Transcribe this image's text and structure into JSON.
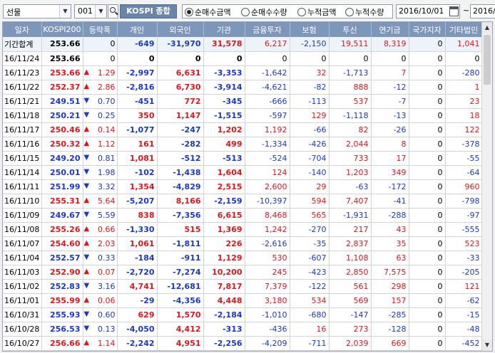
{
  "toolbar": {
    "market": "선물",
    "code": "001",
    "index_button": "KOSPI 종합",
    "radios": [
      {
        "label": "순매수금액",
        "checked": true
      },
      {
        "label": "순매수수량",
        "checked": false
      },
      {
        "label": "누적금액",
        "checked": false
      },
      {
        "label": "누적수량",
        "checked": false
      }
    ],
    "start_date": "2016/10/01",
    "tilde": "~",
    "end_date": "2016/"
  },
  "columns": [
    "일자",
    "KOSPI200",
    "등락폭",
    "개인",
    "외국인",
    "기관",
    "금융투자",
    "보험",
    "투신",
    "연기금",
    "국가지자",
    "기타법인"
  ],
  "rows": [
    {
      "d": "기간합계",
      "k": "253.66",
      "dir": "",
      "c": "0",
      "v": [
        "-649",
        "-31,970",
        "31,578",
        "6,217",
        "-2,150",
        "19,511",
        "8,319",
        "0",
        "1,041"
      ]
    },
    {
      "d": "16/11/24",
      "k": "253.66",
      "dir": "",
      "c": "0",
      "v": [
        "0",
        "0",
        "0",
        "0",
        "0",
        "0",
        "0",
        "0",
        "0"
      ]
    },
    {
      "d": "16/11/23",
      "k": "253.66",
      "dir": "up",
      "c": "1.29",
      "v": [
        "-2,997",
        "6,631",
        "-3,353",
        "-1,642",
        "32",
        "-1,713",
        "7",
        "0",
        "-280"
      ]
    },
    {
      "d": "16/11/22",
      "k": "252.37",
      "dir": "up",
      "c": "2.86",
      "v": [
        "-2,816",
        "6,730",
        "-3,914",
        "-4,621",
        "-82",
        "888",
        "-12",
        "0",
        "1"
      ]
    },
    {
      "d": "16/11/21",
      "k": "249.51",
      "dir": "down",
      "c": "0.70",
      "v": [
        "-451",
        "772",
        "-345",
        "-666",
        "-113",
        "537",
        "-7",
        "0",
        "23"
      ]
    },
    {
      "d": "16/11/18",
      "k": "250.21",
      "dir": "down",
      "c": "0.25",
      "v": [
        "350",
        "1,147",
        "-1,515",
        "-597",
        "129",
        "-1,118",
        "-13",
        "0",
        "18"
      ]
    },
    {
      "d": "16/11/17",
      "k": "250.46",
      "dir": "up",
      "c": "0.14",
      "v": [
        "-1,077",
        "-247",
        "1,202",
        "1,192",
        "-66",
        "82",
        "-26",
        "0",
        "122"
      ]
    },
    {
      "d": "16/11/16",
      "k": "250.32",
      "dir": "up",
      "c": "1.12",
      "v": [
        "161",
        "-282",
        "499",
        "-1,334",
        "-426",
        "2,044",
        "8",
        "0",
        "-378"
      ]
    },
    {
      "d": "16/11/15",
      "k": "249.20",
      "dir": "down",
      "c": "0.81",
      "v": [
        "1,081",
        "-512",
        "-513",
        "-524",
        "-704",
        "733",
        "17",
        "0",
        "-55"
      ]
    },
    {
      "d": "16/11/14",
      "k": "250.01",
      "dir": "down",
      "c": "1.98",
      "v": [
        "-102",
        "-1,438",
        "1,604",
        "124",
        "-140",
        "1,203",
        "349",
        "0",
        "-64"
      ]
    },
    {
      "d": "16/11/11",
      "k": "251.99",
      "dir": "down",
      "c": "3.32",
      "v": [
        "1,354",
        "-4,829",
        "2,515",
        "2,600",
        "29",
        "-63",
        "-172",
        "0",
        "960"
      ]
    },
    {
      "d": "16/11/10",
      "k": "255.31",
      "dir": "up",
      "c": "5.64",
      "v": [
        "-5,207",
        "8,166",
        "-2,159",
        "-10,397",
        "594",
        "7,407",
        "-41",
        "0",
        "-798"
      ]
    },
    {
      "d": "16/11/09",
      "k": "249.67",
      "dir": "down",
      "c": "5.59",
      "v": [
        "838",
        "-7,356",
        "6,615",
        "8,468",
        "565",
        "-1,931",
        "-288",
        "0",
        "-97"
      ]
    },
    {
      "d": "16/11/08",
      "k": "255.26",
      "dir": "up",
      "c": "0.66",
      "v": [
        "-1,330",
        "515",
        "1,369",
        "1,242",
        "-270",
        "217",
        "43",
        "0",
        "-555"
      ]
    },
    {
      "d": "16/11/07",
      "k": "254.60",
      "dir": "up",
      "c": "2.03",
      "v": [
        "1,061",
        "-1,811",
        "226",
        "-2,616",
        "-35",
        "2,837",
        "35",
        "0",
        "523"
      ]
    },
    {
      "d": "16/11/04",
      "k": "252.57",
      "dir": "down",
      "c": "0.33",
      "v": [
        "-184",
        "-911",
        "1,129",
        "530",
        "-607",
        "1,108",
        "63",
        "0",
        "-33"
      ]
    },
    {
      "d": "16/11/03",
      "k": "252.90",
      "dir": "up",
      "c": "0.07",
      "v": [
        "-2,720",
        "-7,274",
        "10,200",
        "245",
        "-423",
        "2,850",
        "7,575",
        "0",
        "-205"
      ]
    },
    {
      "d": "16/11/02",
      "k": "252.83",
      "dir": "down",
      "c": "3.16",
      "v": [
        "4,741",
        "-12,681",
        "7,817",
        "7,379",
        "-122",
        "561",
        "298",
        "0",
        "121"
      ]
    },
    {
      "d": "16/11/01",
      "k": "255.99",
      "dir": "up",
      "c": "0.06",
      "v": [
        "-29",
        "-4,356",
        "4,448",
        "3,180",
        "534",
        "569",
        "157",
        "0",
        "-62"
      ]
    },
    {
      "d": "16/10/31",
      "k": "255.93",
      "dir": "down",
      "c": "0.60",
      "v": [
        "629",
        "1,570",
        "-2,184",
        "-1,010",
        "-680",
        "-147",
        "-285",
        "0",
        "-15"
      ]
    },
    {
      "d": "16/10/28",
      "k": "256.53",
      "dir": "down",
      "c": "0.13",
      "v": [
        "-4,050",
        "4,412",
        "-313",
        "-436",
        "16",
        "273",
        "-128",
        "0",
        "-48"
      ]
    },
    {
      "d": "16/10/27",
      "k": "256.66",
      "dir": "up",
      "c": "1.14",
      "v": [
        "-2,242",
        "4,951",
        "-2,256",
        "-4,209",
        "-711",
        "2,039",
        "669",
        "0",
        "-452"
      ]
    }
  ],
  "colors": {
    "up": "#e0151b",
    "down": "#1a37c8",
    "header": "#7d97bb"
  },
  "arrows": {
    "up": "▲",
    "down": "▼"
  }
}
